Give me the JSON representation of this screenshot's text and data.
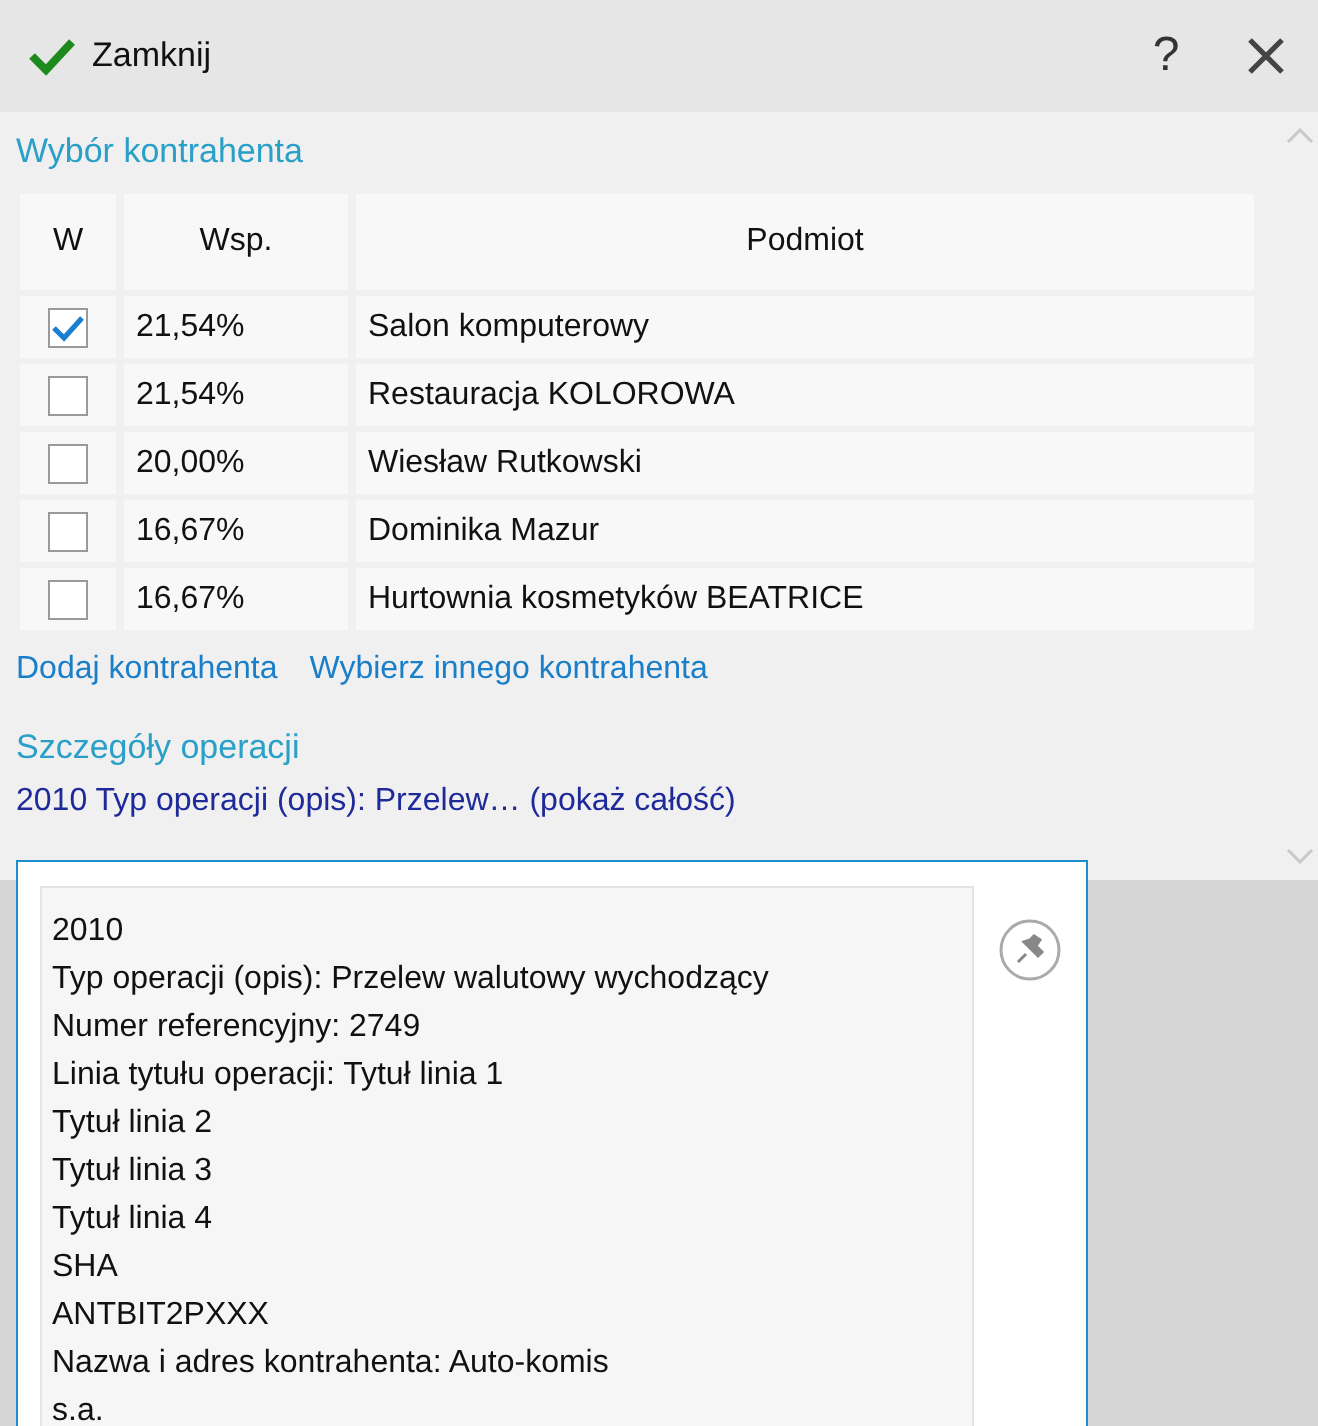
{
  "toolbar": {
    "close_label": "Zamknij",
    "help": "?"
  },
  "contractor_section": {
    "title": "Wybór kontrahenta",
    "table": {
      "columns": [
        "W",
        "Wsp.",
        "Podmiot"
      ],
      "rows": [
        {
          "checked": true,
          "share": "21,54%",
          "entity": "Salon komputerowy"
        },
        {
          "checked": false,
          "share": "21,54%",
          "entity": "Restauracja KOLOROWA"
        },
        {
          "checked": false,
          "share": "20,00%",
          "entity": "Wiesław Rutkowski"
        },
        {
          "checked": false,
          "share": "16,67%",
          "entity": "Dominika Mazur"
        },
        {
          "checked": false,
          "share": "16,67%",
          "entity": "Hurtownia kosmetyków BEATRICE"
        }
      ]
    },
    "links": [
      "Dodaj kontrahenta",
      "Wybierz innego kontrahenta"
    ]
  },
  "details_section": {
    "title": "Szczegóły operacji",
    "summary": "2010 Typ operacji (opis): Przelew… (pokaż całość)"
  },
  "popup": {
    "lines": [
      "2010",
      "Typ operacji (opis): Przelew walutowy wychodzący",
      "Numer referencyjny: 2749",
      "Linia tytułu operacji: Tytuł linia 1",
      "Tytuł linia 2",
      "Tytuł linia 3",
      "Tytuł linia 4",
      "SHA",
      "ANTBIT2PXXX",
      "Nazwa i adres kontrahenta: Auto-komis",
      "s.a."
    ]
  }
}
